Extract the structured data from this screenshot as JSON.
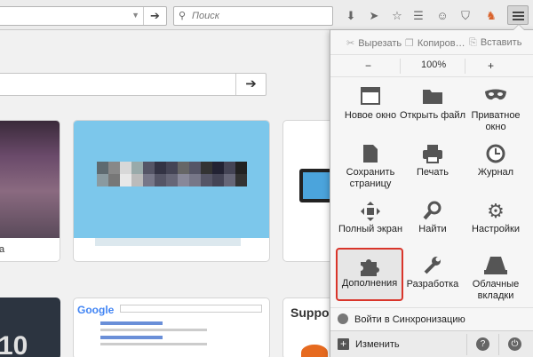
{
  "toolbar": {
    "go_arrow": "➔",
    "search_placeholder": "Поиск",
    "icons": [
      "download-icon",
      "send-icon",
      "star-icon",
      "reading-icon",
      "pocket-icon",
      "addon-icon"
    ]
  },
  "edit": {
    "cut": "Вырезать",
    "copy": "Копиров…",
    "paste": "Вставить"
  },
  "zoom": {
    "minus": "−",
    "value": "100%",
    "plus": "+"
  },
  "grid": [
    {
      "label": "Новое окно",
      "icon": "new-window-icon"
    },
    {
      "label": "Открыть файл",
      "icon": "folder-icon"
    },
    {
      "label": "Приватное окно",
      "icon": "mask-icon"
    },
    {
      "label": "Сохранить страницу",
      "icon": "save-page-icon"
    },
    {
      "label": "Печать",
      "icon": "printer-icon"
    },
    {
      "label": "Журнал",
      "icon": "clock-icon"
    },
    {
      "label": "Полный экран",
      "icon": "fullscreen-icon"
    },
    {
      "label": "Найти",
      "icon": "magnifier-icon"
    },
    {
      "label": "Настройки",
      "icon": "gear-icon"
    },
    {
      "label": "Дополнения",
      "icon": "puzzle-icon"
    },
    {
      "label": "Разработка",
      "icon": "wrench-icon"
    },
    {
      "label": "Облачные вкладки",
      "icon": "cloud-tabs-icon"
    }
  ],
  "sync": {
    "label": "Войти в Синхронизацию"
  },
  "footer": {
    "customize": "Изменить",
    "help": "?",
    "power": "⏻"
  },
  "tiles": {
    "first_caption": "а",
    "google_logo": "Google",
    "support_text": "Support",
    "big_number": "10"
  },
  "colors": {
    "highlight_border": "#d9352b",
    "tile_blue": "#7cc7eb"
  }
}
